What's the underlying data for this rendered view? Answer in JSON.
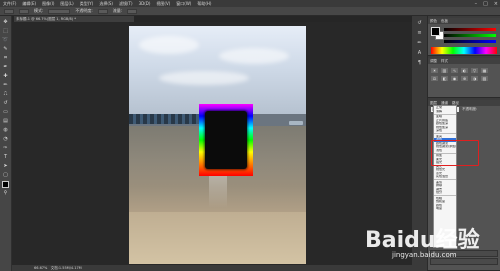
{
  "menubar": {
    "items": [
      "文件(F)",
      "编辑(E)",
      "图像(I)",
      "图层(L)",
      "类型(Y)",
      "选择(S)",
      "滤镜(T)",
      "3D(D)",
      "视图(V)",
      "窗口(W)",
      "帮助(H)"
    ],
    "controls": [
      "–",
      "□",
      "×"
    ]
  },
  "optionsbar": {
    "mode_label": "模式:",
    "opacity_label": "不透明度:",
    "flow_label": "流量:"
  },
  "document": {
    "tab_title": "未标题-1 @ 66.7%(图层 1, RGB/8) *"
  },
  "statusbar": {
    "zoom": "66.67%",
    "doc_size": "文档:1.55M/4.17M"
  },
  "color_panel": {
    "tabs": [
      "颜色",
      "色板"
    ]
  },
  "adjustments_panel": {
    "tabs": [
      "调整",
      "样式"
    ]
  },
  "layers_panel": {
    "tabs": [
      "图层",
      "通道",
      "路径"
    ],
    "blend_mode": "正常",
    "opacity_label": "不透明度:"
  },
  "blend_dropdown": {
    "groups": [
      [
        "正常",
        "溶解"
      ],
      [
        "变暗",
        "正片叠底",
        "颜色加深",
        "线性加深",
        "深色"
      ],
      [
        "变亮",
        "滤色",
        "颜色减淡",
        "线性减淡(添加)",
        "浅色"
      ],
      [
        "叠加",
        "柔光",
        "强光",
        "亮光",
        "线性光",
        "点光",
        "实色混合"
      ],
      [
        "差值",
        "排除",
        "减去",
        "划分"
      ],
      [
        "色相",
        "饱和度",
        "颜色",
        "明度"
      ]
    ],
    "selected": "滤色"
  },
  "watermark": {
    "text": "Baidu经验",
    "url": "jingyan.baidu.com"
  },
  "colors": {
    "highlight": "#e02020",
    "selected_item": "#2f6fd8"
  }
}
